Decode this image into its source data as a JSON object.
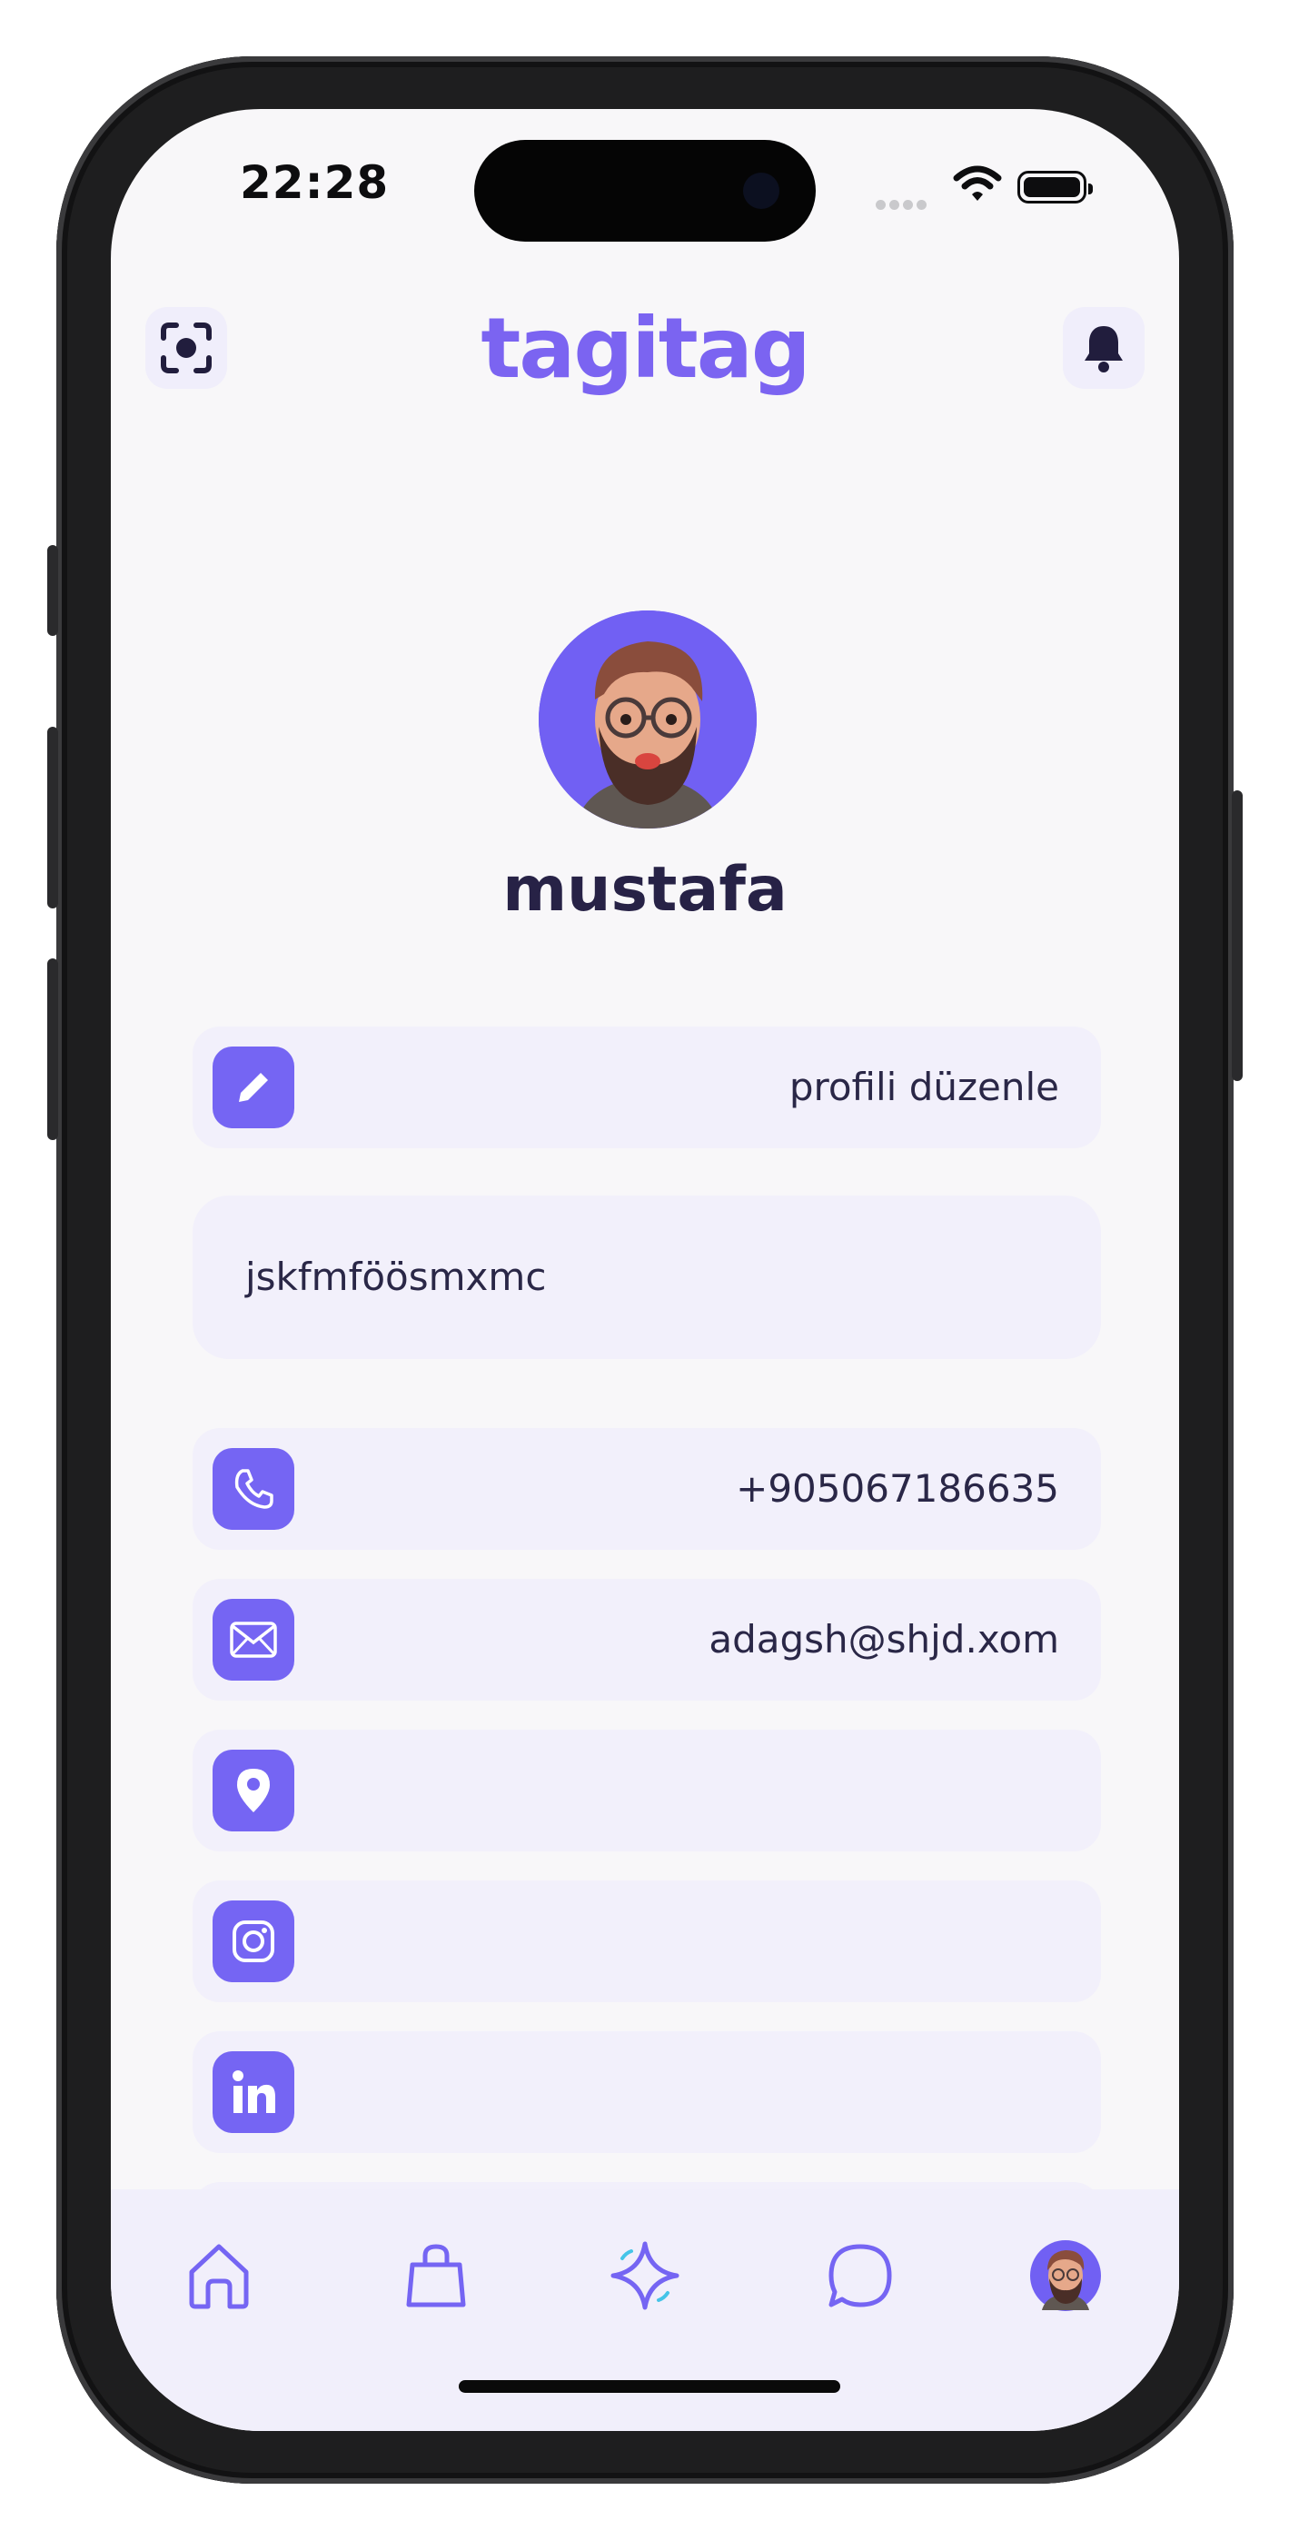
{
  "status": {
    "time": "22:28"
  },
  "header": {
    "brand": "tagitag",
    "scan_icon": "scan-icon",
    "bell_icon": "bell-icon"
  },
  "profile": {
    "username": "mustafa"
  },
  "rows": {
    "edit": {
      "label": "profili düzenle",
      "icon": "pencil-icon"
    },
    "bio": {
      "text": "jskfmföösmxmc"
    },
    "phone": {
      "value": "+905067186635",
      "icon": "phone-icon"
    },
    "email": {
      "value": "adagsh@shjd.xom",
      "icon": "mail-icon"
    },
    "location": {
      "value": "",
      "icon": "location-icon"
    },
    "instagram": {
      "value": "",
      "icon": "instagram-icon"
    },
    "linkedin": {
      "value": "",
      "icon": "linkedin-icon"
    }
  },
  "tabbar": {
    "items": [
      "home-icon",
      "bag-icon",
      "sparkle-icon",
      "chat-icon",
      "avatar"
    ]
  },
  "colors": {
    "accent": "#7565f3",
    "brand": "#7b64f1",
    "text": "#2a2747",
    "row_bg": "#f2f0fb"
  }
}
